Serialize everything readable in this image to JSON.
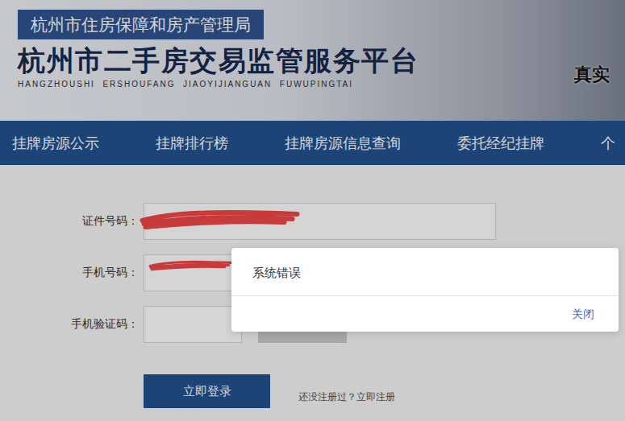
{
  "header": {
    "department": "杭州市住房保障和房产管理局",
    "title": "杭州市二手房交易监管服务平台",
    "subtitle": "HANGZHOUSHI  ERSHOUFANG  JIAOYIJIANGUAN  FUWUPINGTAI",
    "slogan": "真实"
  },
  "nav": [
    {
      "label": "挂牌房源公示"
    },
    {
      "label": "挂牌排行榜"
    },
    {
      "label": "挂牌房源信息查询"
    },
    {
      "label": "委托经纪挂牌"
    },
    {
      "label": "个"
    }
  ],
  "form": {
    "fields": [
      {
        "label": "证件号码：",
        "kind": "text",
        "redacted": true
      },
      {
        "label": "手机号码：",
        "kind": "text",
        "redacted": true
      },
      {
        "label": "手机验证码：",
        "kind": "code",
        "redacted": false
      }
    ],
    "submit": "立即登录",
    "register_prompt": "还没注册过？",
    "register_link": "立即注册"
  },
  "dialog": {
    "message": "系统错误",
    "close": "关闭"
  }
}
